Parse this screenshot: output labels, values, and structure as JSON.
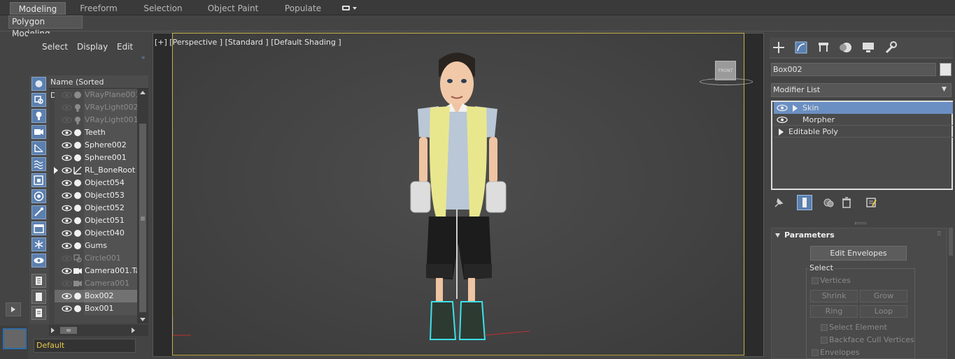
{
  "ribbon": {
    "tabs": [
      "Modeling",
      "Freeform",
      "Selection",
      "Object Paint",
      "Populate"
    ],
    "active_tab": "Modeling",
    "sub_tab": "Polygon Modeling"
  },
  "scene_explorer": {
    "menus": [
      "Select",
      "Display",
      "Edit"
    ],
    "column_header": "Name (Sorted Descending)",
    "rows": [
      {
        "name": "VRayPlane001",
        "kind": "geometry",
        "dim": true,
        "eye": false,
        "selected": false
      },
      {
        "name": "VRayLight002",
        "kind": "light",
        "dim": true,
        "eye": false,
        "selected": false
      },
      {
        "name": "VRayLight001",
        "kind": "light",
        "dim": true,
        "eye": false,
        "selected": false
      },
      {
        "name": "Teeth",
        "kind": "geometry",
        "dim": false,
        "eye": true,
        "selected": false
      },
      {
        "name": "Sphere002",
        "kind": "geometry",
        "dim": false,
        "eye": true,
        "selected": false
      },
      {
        "name": "Sphere001",
        "kind": "geometry",
        "dim": false,
        "eye": true,
        "selected": false
      },
      {
        "name": "RL_BoneRoot",
        "kind": "bone",
        "dim": false,
        "eye": true,
        "selected": false,
        "expander": true
      },
      {
        "name": "Object054",
        "kind": "geometry",
        "dim": false,
        "eye": true,
        "selected": false
      },
      {
        "name": "Object053",
        "kind": "geometry",
        "dim": false,
        "eye": true,
        "selected": false
      },
      {
        "name": "Object052",
        "kind": "geometry",
        "dim": false,
        "eye": true,
        "selected": false
      },
      {
        "name": "Object051",
        "kind": "geometry",
        "dim": false,
        "eye": true,
        "selected": false
      },
      {
        "name": "Object040",
        "kind": "geometry",
        "dim": false,
        "eye": true,
        "selected": false
      },
      {
        "name": "Gums",
        "kind": "geometry",
        "dim": false,
        "eye": true,
        "selected": false
      },
      {
        "name": "Circle001",
        "kind": "shape",
        "dim": true,
        "eye": false,
        "selected": false
      },
      {
        "name": "Camera001.Ta",
        "kind": "camera",
        "dim": false,
        "eye": true,
        "selected": false
      },
      {
        "name": "Camera001",
        "kind": "camera",
        "dim": true,
        "eye": false,
        "selected": false
      },
      {
        "name": "Box002",
        "kind": "geometry",
        "dim": false,
        "eye": true,
        "selected": true
      },
      {
        "name": "Box001",
        "kind": "geometry",
        "dim": false,
        "eye": true,
        "selected": false
      }
    ],
    "layer": "Default"
  },
  "viewport": {
    "label": "[+] [Perspective ] [Standard ] [Default Shading ]",
    "view_cube_label": "FRONT"
  },
  "command_panel": {
    "tab_icons": [
      "create-icon",
      "modify-icon",
      "hierarchy-icon",
      "motion-icon",
      "display-icon",
      "utilities-icon"
    ],
    "object_name": "Box002",
    "modifier_list_label": "Modifier List",
    "stack": [
      {
        "label": "Skin",
        "selected": true,
        "eye": true,
        "arrow": true
      },
      {
        "label": "Morpher",
        "selected": false,
        "eye": true,
        "arrow": false
      },
      {
        "label": "Editable Poly",
        "selected": false,
        "eye": false,
        "arrow": true
      }
    ],
    "rollout_title": "Parameters",
    "edit_envelopes": "Edit Envelopes",
    "select_group": "Select",
    "vertices_label": "Vertices",
    "shrink": "Shrink",
    "grow": "Grow",
    "ring": "Ring",
    "loop": "Loop",
    "select_element": "Select Element",
    "backface_cull": "Backface Cull Vertices",
    "envelopes": "Envelopes"
  },
  "colors": {
    "selection_blue": "#6b8fc2",
    "viewport_border": "#c7b14a",
    "layer_text": "#e8c94a"
  }
}
